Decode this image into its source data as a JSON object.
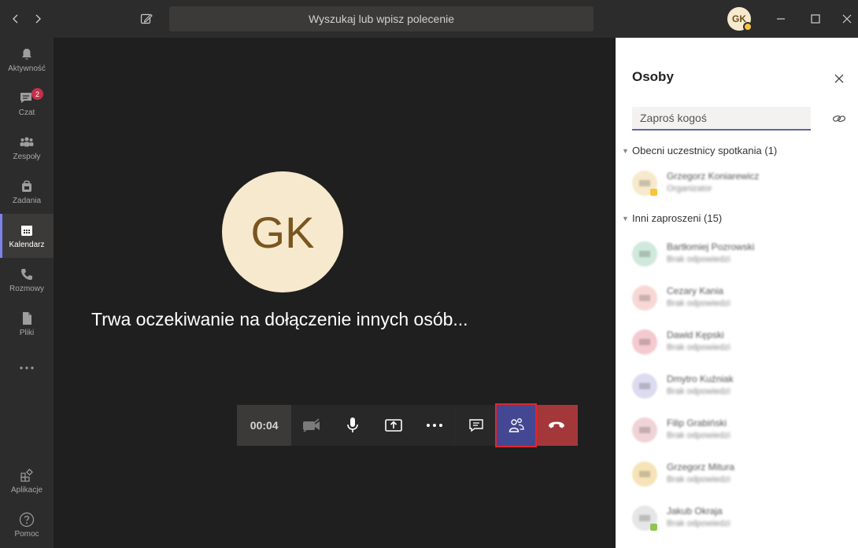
{
  "titlebar": {
    "search_placeholder": "Wyszukaj lub wpisz polecenie",
    "user_initials": "GK",
    "status_color": "#f8c43a"
  },
  "rail": {
    "items": [
      {
        "label": "Aktywność",
        "icon": "bell-icon"
      },
      {
        "label": "Czat",
        "icon": "chat-icon",
        "badge": "2"
      },
      {
        "label": "Zespoły",
        "icon": "teams-icon"
      },
      {
        "label": "Zadania",
        "icon": "assignments-icon"
      },
      {
        "label": "Kalendarz",
        "icon": "calendar-icon",
        "active": true
      },
      {
        "label": "Rozmowy",
        "icon": "phone-icon"
      },
      {
        "label": "Pliki",
        "icon": "file-icon"
      },
      {
        "label": "",
        "icon": "more-icon"
      },
      {
        "label": "Aplikacje",
        "icon": "apps-icon"
      },
      {
        "label": "Pomoc",
        "icon": "help-icon"
      }
    ]
  },
  "stage": {
    "avatar_initials": "GK",
    "avatar_color": "#f6e9cd",
    "waiting_text": "Trwa oczekiwanie na dołączenie innych osób..."
  },
  "controls": {
    "timer": "00:04",
    "accent": "#444791",
    "hangup_color": "#a4373a"
  },
  "panel": {
    "title": "Osoby",
    "invite_placeholder": "Zaproś kogoś",
    "present_header": "Obecni uczestnicy spotkania (1)",
    "others_header": "Inni zaproszeni (15)",
    "present": [
      {
        "name": "Grzegorz Koniarewicz",
        "sub": "Organizator",
        "color": "#f6e9cd",
        "status": "#f8c43a"
      }
    ],
    "others": [
      {
        "name": "Bartłomiej Pozrowski",
        "sub": "Brak odpowiedzi",
        "color": "#cfe9dc"
      },
      {
        "name": "Cezary Kania",
        "sub": "Brak odpowiedzi",
        "color": "#f7d8d6"
      },
      {
        "name": "Dawid Kępski",
        "sub": "Brak odpowiedzi",
        "color": "#f4c9d0"
      },
      {
        "name": "Dmytro Kuźniak",
        "sub": "Brak odpowiedzi",
        "color": "#dcdbef"
      },
      {
        "name": "Filip Grabiński",
        "sub": "Brak odpowiedzi",
        "color": "#f0d3d6"
      },
      {
        "name": "Grzegorz Mitura",
        "sub": "Brak odpowiedzi",
        "color": "#f6e4b8"
      },
      {
        "name": "Jakub Okraja",
        "sub": "Brak odpowiedzi",
        "color": "#e6e6e6",
        "status": "#92c353"
      }
    ]
  }
}
